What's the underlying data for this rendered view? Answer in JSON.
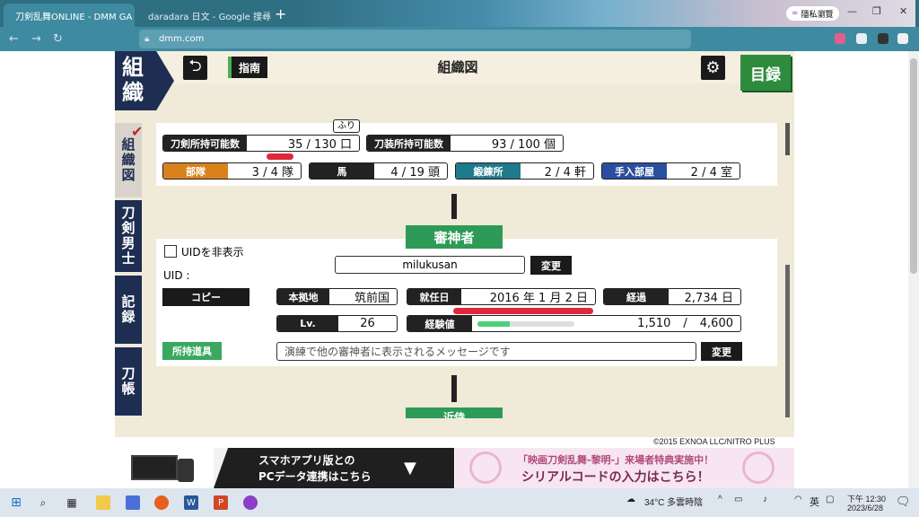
{
  "browser": {
    "tabs": [
      {
        "title": "刀剣乱舞ONLINE - DMM GA",
        "active": true
      },
      {
        "title": "daradara 日文 - Google 搜尋",
        "active": false
      }
    ],
    "url_domain": "dmm.com",
    "profile_name": "隱私瀏覽",
    "new_tab": "+",
    "window_controls": [
      "—",
      "❐",
      "✕"
    ]
  },
  "game": {
    "logo": "組\n織",
    "guide_label": "指南",
    "title": "組織図",
    "catalog_label": "目録",
    "side_tabs": [
      "組織図",
      "刀剣男士",
      "記録",
      "刀帳"
    ],
    "furigana": "ふり",
    "stats_top": [
      {
        "label": "刀剣所持可能数",
        "value": "35 / 130 口"
      },
      {
        "label": "刀装所持可能数",
        "value": "93 / 100 個"
      }
    ],
    "stats_row": [
      {
        "label": "部隊",
        "value": "3 / 4 隊",
        "color": "#d9821c"
      },
      {
        "label": "馬",
        "value": "4 / 19 頭",
        "color": "#222222"
      },
      {
        "label": "鍛錬所",
        "value": "2 / 4 軒",
        "color": "#1f7a8c"
      },
      {
        "label": "手入部屋",
        "value": "2 / 4 室",
        "color": "#2a4fa0"
      }
    ],
    "saniwa_label": "審神者",
    "hide_uid_label": "UIDを非表示",
    "uid_label": "UID :",
    "copy_label": "コピー",
    "name": "milukusan",
    "change_label": "変更",
    "home_label": "本拠地",
    "home_value": "筑前国",
    "start_label": "就任日",
    "start_value": "2016 年 1 月 2 日",
    "elapsed_label": "経過",
    "elapsed_value": "2,734 日",
    "lv_label": "Lv.",
    "lv_value": "26",
    "exp_label": "経験値",
    "exp_value": "1,510",
    "exp_sep": "/",
    "exp_max": "4,600",
    "exp_fraction": 0.33,
    "items_label": "所持道具",
    "message_placeholder": "演練で他の審神者に表示されるメッセージです",
    "message_change": "変更",
    "next_section": "近侍",
    "copyright": "©2015 EXNOA LLC/NITRO PLUS"
  },
  "banners": {
    "left_line1": "スマホアプリ版との",
    "left_line2": "PCデータ連携はこちら",
    "right_line1": "「映画刀剣乱舞-黎明-」来場者特典実施中！",
    "right_line2": "シリアルコードの入力はこちら！"
  },
  "taskbar": {
    "weather": "34°C  多雲時陰",
    "ime": "英",
    "time": "下午 12:30",
    "date": "2023/6/28"
  }
}
